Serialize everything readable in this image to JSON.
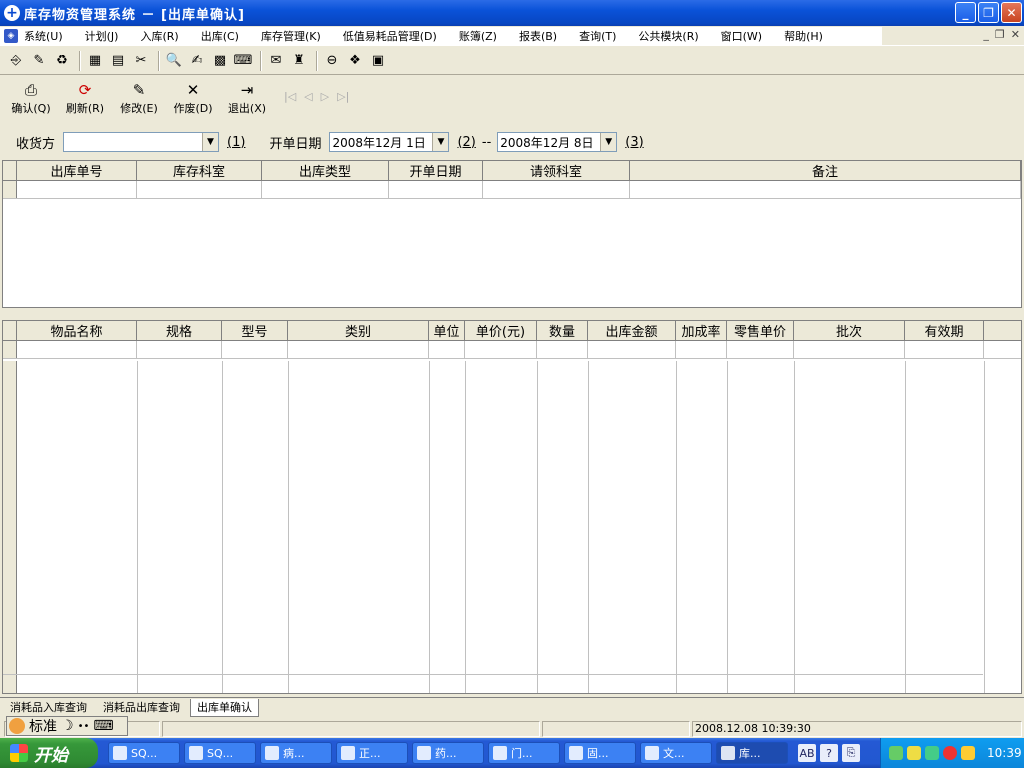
{
  "window": {
    "title": "库存物资管理系统 － [出库单确认]",
    "buttons": {
      "minimize": "_",
      "restore": "❐",
      "close": "✕"
    }
  },
  "menu": {
    "items": [
      "系统(U)",
      "计划(J)",
      "入库(R)",
      "出库(C)",
      "库存管理(K)",
      "低值易耗品管理(D)",
      "账簿(Z)",
      "报表(B)",
      "查询(T)",
      "公共模块(R)",
      "窗口(W)",
      "帮助(H)"
    ],
    "mdi": {
      "minimize": "_",
      "restore": "❐",
      "close": "✕"
    }
  },
  "toolbar": {
    "icons": [
      "⎆",
      "✎",
      "♻",
      "▦",
      "▤",
      "✂",
      "🔍",
      "✍",
      "▩",
      "⌨",
      "✉",
      "♜",
      "⊖",
      "❖",
      "▣"
    ]
  },
  "actions": [
    {
      "label": "确认(Q)",
      "icon": "⎙"
    },
    {
      "label": "刷新(R)",
      "icon": "⟳"
    },
    {
      "label": "修改(E)",
      "icon": "✎"
    },
    {
      "label": "作废(D)",
      "icon": "✕"
    },
    {
      "label": "退出(X)",
      "icon": "⇥"
    }
  ],
  "nav": [
    "|◁",
    "◁",
    "▷",
    "▷|"
  ],
  "filter": {
    "receiver_label": "收货方",
    "receiver_value": "",
    "hotkey1": "(1)",
    "date_label": "开单日期",
    "date_from": "2008年12月 1日",
    "hotkey2": "(2)",
    "dash": "--",
    "date_to": "2008年12月 8日",
    "hotkey3": "(3)"
  },
  "top_grid": {
    "columns": [
      "出库单号",
      "库存科室",
      "出库类型",
      "开单日期",
      "请领科室",
      "备注"
    ]
  },
  "bottom_grid": {
    "columns": [
      "物品名称",
      "规格",
      "型号",
      "类别",
      "单位",
      "单价(元)",
      "数量",
      "出库金额",
      "加成率",
      "零售单价",
      "批次",
      "有效期"
    ]
  },
  "tabs": [
    "消耗品入库查询",
    "消耗品出库查询",
    "出库单确认"
  ],
  "ime": {
    "mode": "标准",
    "icon1": "☽",
    "icon2": "••",
    "icon3": "⌨"
  },
  "status": {
    "datetime": "2008.12.08 10:39:30"
  },
  "taskbar": {
    "start_label": "开始",
    "tasks": [
      "SQ...",
      "SQ...",
      "病...",
      "正...",
      "药...",
      "门...",
      "固...",
      "文...",
      "库..."
    ],
    "quick": [
      "AB",
      "?",
      "⎘"
    ],
    "clock": "10:39"
  }
}
